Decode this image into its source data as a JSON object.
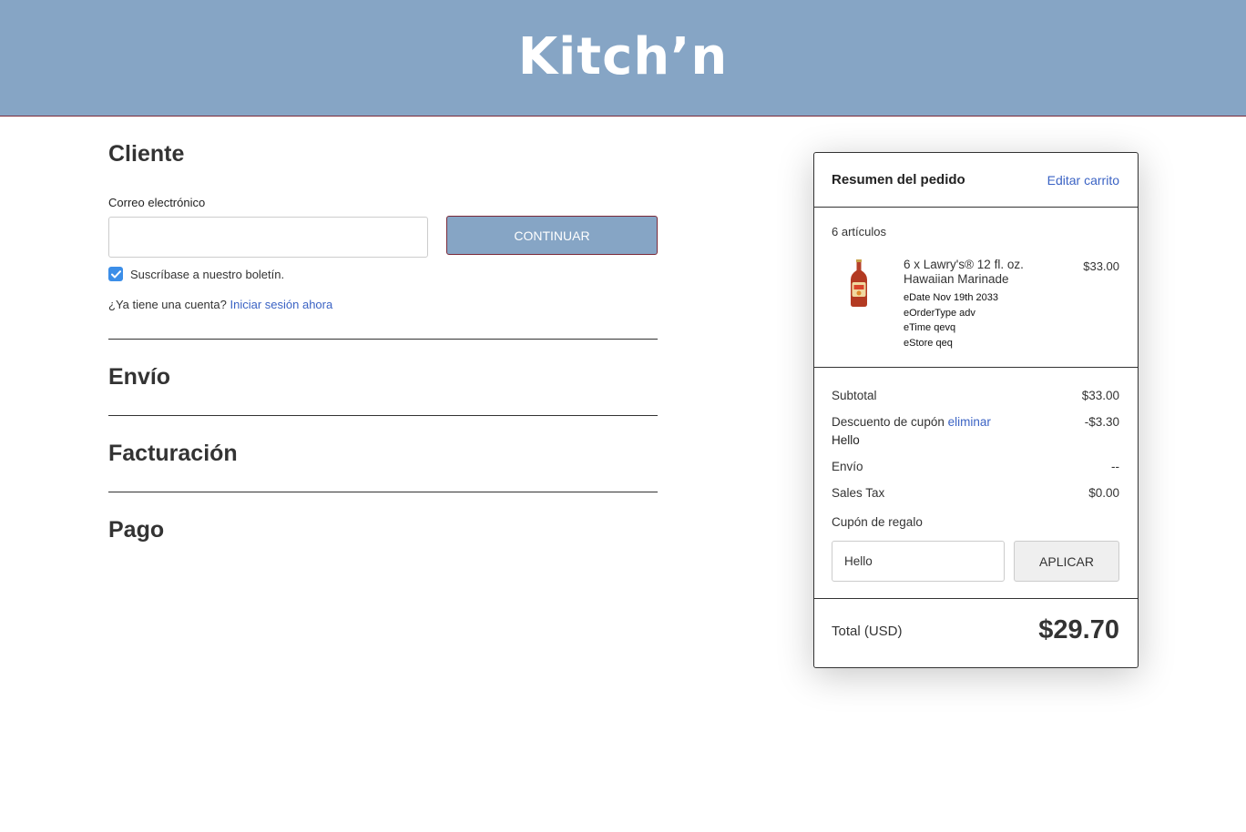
{
  "header": {
    "logo": "Kitch’n"
  },
  "checkout": {
    "customer_title": "Cliente",
    "email_label": "Correo electrónico",
    "email_value": "",
    "continue_label": "CONTINUAR",
    "newsletter_label": "Suscríbase a nuestro boletín.",
    "newsletter_checked": true,
    "account_question": "¿Ya tiene una cuenta?",
    "signin_link": "Iniciar sesión ahora",
    "shipping_title": "Envío",
    "billing_title": "Facturación",
    "payment_title": "Pago"
  },
  "summary": {
    "title": "Resumen del pedido",
    "edit_cart": "Editar carrito",
    "item_count": "6 artículos",
    "product": {
      "name": "6 x Lawry's® 12 fl. oz. Hawaiian Marinade",
      "price": "$33.00",
      "options": [
        "eDate Nov 19th 2033",
        "eOrderType adv",
        "eTime qevq",
        "eStore qeq"
      ]
    },
    "subtotal_label": "Subtotal",
    "subtotal_value": "$33.00",
    "discount_label": "Descuento de cupón",
    "discount_remove": "eliminar",
    "discount_value": "-$3.30",
    "coupon_code": "Hello",
    "shipping_label": "Envío",
    "shipping_value": "--",
    "tax_label": "Sales Tax",
    "tax_value": "$0.00",
    "gift_label": "Cupón de regalo",
    "gift_value": "Hello",
    "apply_label": "APLICAR",
    "total_label": "Total (USD)",
    "total_value": "$29.70"
  },
  "colors": {
    "header_bg": "#86a5c5",
    "button_bg": "#86a5c5",
    "link": "#3b63c4",
    "checkbox": "#3b8ee8"
  }
}
